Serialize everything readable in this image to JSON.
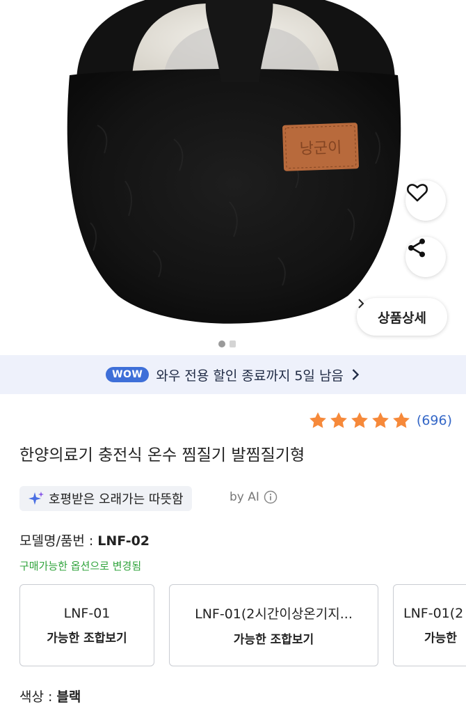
{
  "product_image": {
    "patch_text": "낭군이",
    "colors": {
      "fur": "#141414",
      "lining": "#ece9e2",
      "patch": "#b86a3c"
    }
  },
  "actions": {
    "wishlist_icon": "heart-icon",
    "share_icon": "share-icon",
    "detail_label": "상품상세"
  },
  "carousel": {
    "current": 1,
    "total": 2
  },
  "wow_banner": {
    "badge": "WOW",
    "text": "와우 전용 할인 종료까지 5일 남음"
  },
  "rating": {
    "stars": 5,
    "count": "(696)",
    "star_color": "#f6893a"
  },
  "product": {
    "title": "한양의료기 충전식 온수 찜질기 발찜질기형"
  },
  "ai_summary": {
    "chip_text": "호평받은 오래가는 따뜻함",
    "by_label": "by AI"
  },
  "model": {
    "label": "모델명/품번 : ",
    "value": "LNF-02",
    "availability_note": "구매가능한 옵션으로 변경됨"
  },
  "options": [
    {
      "name": "LNF-01",
      "sub": "가능한 조합보기"
    },
    {
      "name": "LNF-01(2시간이상온기지...",
      "sub": "가능한 조합보기"
    },
    {
      "name": "LNF-01(2",
      "sub": "가능한"
    }
  ],
  "color": {
    "label": "색상 : ",
    "value": "블랙"
  }
}
